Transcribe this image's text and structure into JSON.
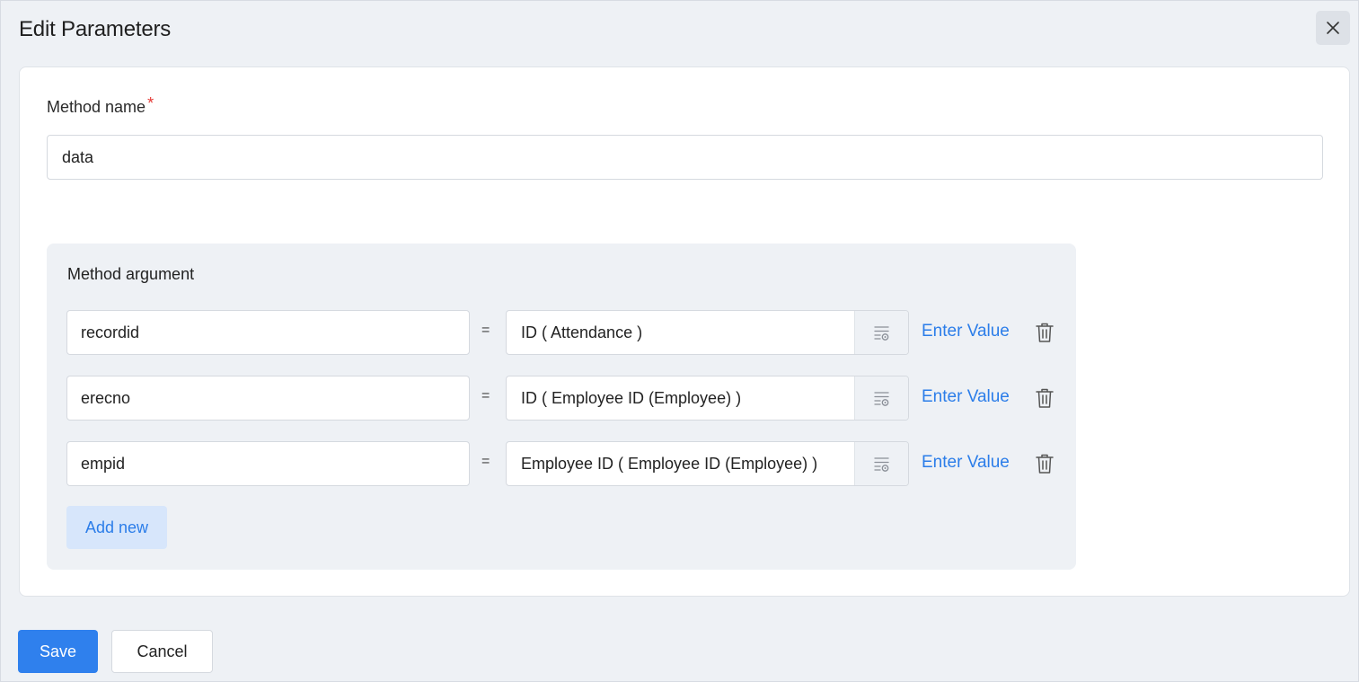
{
  "dialog": {
    "title": "Edit Parameters",
    "close_icon": "close-icon"
  },
  "method": {
    "label": "Method name",
    "required_mark": "*",
    "value": "data"
  },
  "arguments": {
    "title": "Method argument",
    "equals": "=",
    "enter_value_label": "Enter Value",
    "rows": [
      {
        "name": "recordid",
        "value": "ID ( Attendance )"
      },
      {
        "name": "erecno",
        "value": "ID ( Employee ID (Employee) )"
      },
      {
        "name": "empid",
        "value": "Employee ID ( Employee ID (Employee) )"
      }
    ],
    "add_new_label": "Add new",
    "icons": {
      "field_picker": "field-picker-icon",
      "delete": "trash-icon"
    }
  },
  "footer": {
    "save_label": "Save",
    "cancel_label": "Cancel"
  },
  "colors": {
    "accent": "#2f80ed",
    "link": "#2b7de9",
    "required": "#e53935",
    "background": "#eef1f5"
  }
}
